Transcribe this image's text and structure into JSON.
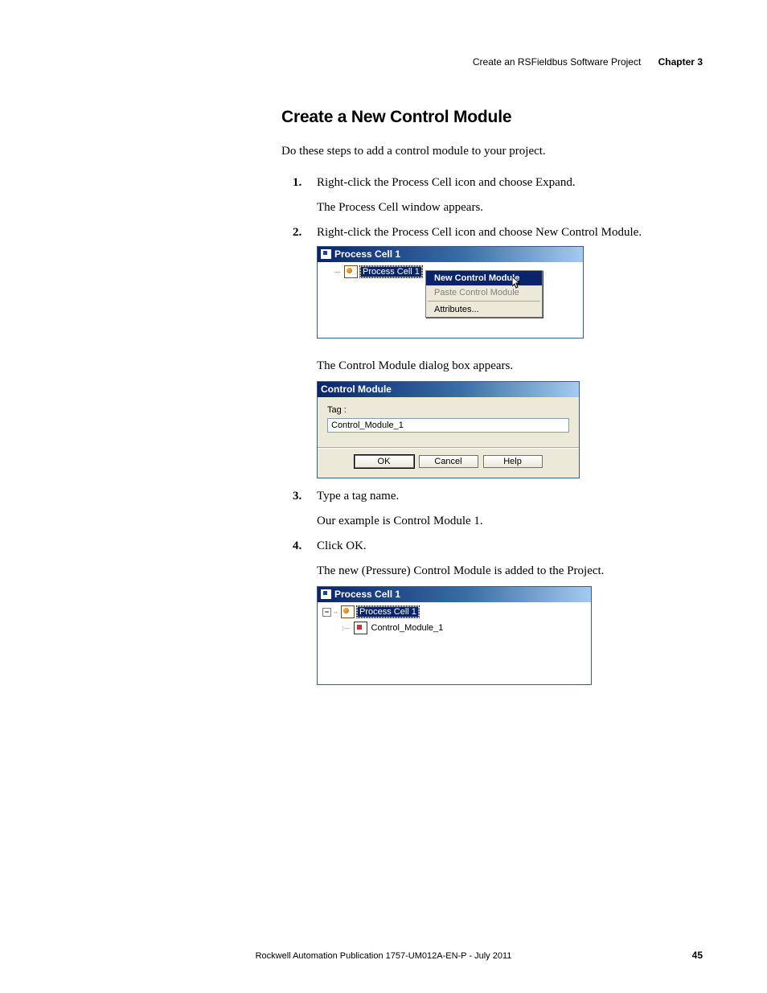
{
  "header": {
    "breadcrumb": "Create an RSFieldbus Software Project",
    "chapter": "Chapter 3"
  },
  "section_title": "Create a New Control Module",
  "intro": "Do these steps to add a control module to your project.",
  "steps": {
    "s1": {
      "num": "1.",
      "text": "Right-click the Process Cell icon and choose Expand.",
      "note": "The Process Cell window appears."
    },
    "s2": {
      "num": "2.",
      "text": "Right-click the Process Cell icon and choose New Control Module.",
      "note": "The Control Module dialog box appears."
    },
    "s3": {
      "num": "3.",
      "text": "Type a tag name.",
      "note": "Our example is Control Module 1."
    },
    "s4": {
      "num": "4.",
      "text": "Click OK.",
      "note": "The new (Pressure) Control Module is added to the Project."
    }
  },
  "shot1": {
    "title": "Process Cell 1",
    "node": "Process Cell 1",
    "menu": {
      "new_control_module": "New Control Module",
      "paste_control_module": "Paste Control Module",
      "attributes": "Attributes..."
    }
  },
  "dialog": {
    "title": "Control Module",
    "tag_label": "Tag :",
    "tag_value": "Control_Module_1",
    "ok": "OK",
    "cancel": "Cancel",
    "help": "Help"
  },
  "shot3": {
    "title": "Process Cell 1",
    "root": "Process Cell 1",
    "child": "Control_Module_1"
  },
  "footer": {
    "pub": "Rockwell Automation Publication 1757-UM012A-EN-P - July 2011",
    "page": "45"
  }
}
